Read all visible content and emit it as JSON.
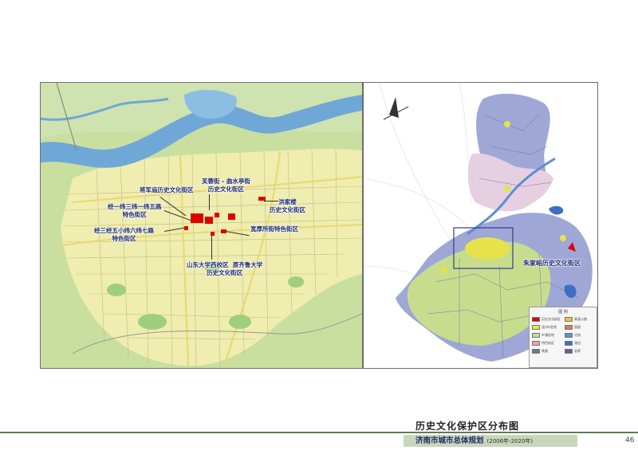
{
  "title": "历史文化保护区分布图",
  "subtitle": "济南市城市总体规划",
  "subtitle_years": "(2006年-2020年)",
  "page_number": "46",
  "left_map": {
    "labels": {
      "jiangjunmiao": "将军庙历史文化街区",
      "furongjie": "芙蓉街 - 曲水亭街\n历史文化街区",
      "jingyi": "经一纬三纬一纬五路\n特色街区",
      "hongjialou": "洪家楼\n历史文化街区",
      "jingsan": "经三经五小纬六纬七路\n特色街区",
      "kuanhousuo": "宽厚所街特色街区",
      "shanda": "山东大学西校区  原齐鲁大学\n历史文化街区"
    }
  },
  "right_map": {
    "labels": {
      "zhujiayu": "朱家峪历史文化街区"
    },
    "legend": {
      "title": "图  例",
      "items": [
        "历史文化街区",
        "县(市)驻地",
        "乡镇驻地",
        "特色街区",
        "铁路",
        "高速公路",
        "国道",
        "河流",
        "湖泊",
        "县界"
      ]
    }
  },
  "colors": {
    "water": "#6fa8d6",
    "district": "#e00000",
    "road": "#f3eeb0",
    "land": "#c9dfa0",
    "frame": "#6d6d6d"
  }
}
